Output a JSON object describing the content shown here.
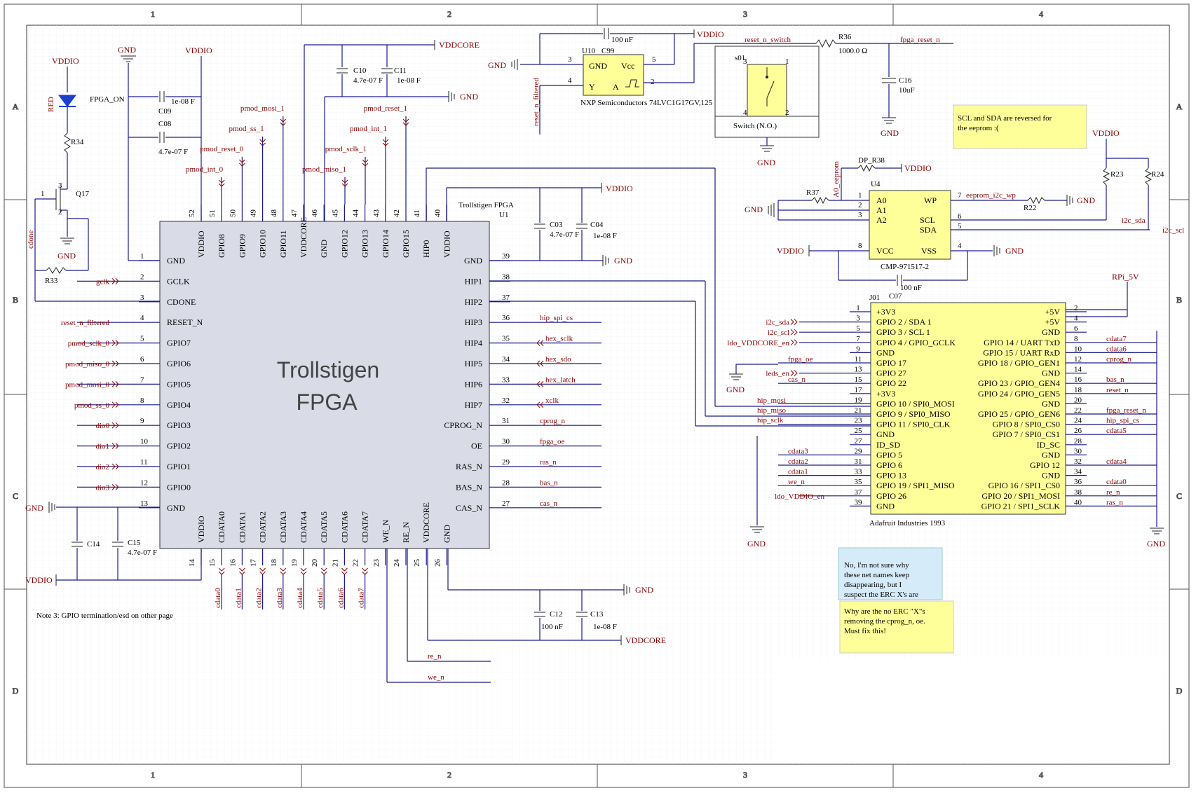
{
  "fpga": {
    "title_line1": "Trollstigen",
    "title_line2": "FPGA",
    "designator": "Trollstigen FPGA",
    "ref": "U1",
    "top_pins": [
      {
        "num": "52",
        "name": "VDDIO",
        "color": "blue"
      },
      {
        "num": "51",
        "name": "GPIO8",
        "color": "black"
      },
      {
        "num": "50",
        "name": "GPIO9",
        "color": "black"
      },
      {
        "num": "49",
        "name": "GPIO10",
        "color": "black"
      },
      {
        "num": "48",
        "name": "GPIO11",
        "color": "black"
      },
      {
        "num": "47",
        "name": "VDDCORE",
        "color": "orange"
      },
      {
        "num": "46",
        "name": "GND",
        "color": "green"
      },
      {
        "num": "45",
        "name": "GPIO12",
        "color": "black"
      },
      {
        "num": "44",
        "name": "GPIO13",
        "color": "black"
      },
      {
        "num": "43",
        "name": "GPIO14",
        "color": "black"
      },
      {
        "num": "42",
        "name": "GPIO15",
        "color": "black"
      },
      {
        "num": "41",
        "name": "HIP0",
        "color": "black"
      },
      {
        "num": "40",
        "name": "VDDIO",
        "color": "blue"
      }
    ],
    "bottom_pins": [
      {
        "num": "14",
        "name": "VDDIO",
        "color": "blue"
      },
      {
        "num": "15",
        "name": "CDATA0",
        "color": "black"
      },
      {
        "num": "16",
        "name": "CDATA1",
        "color": "black"
      },
      {
        "num": "17",
        "name": "CDATA2",
        "color": "black"
      },
      {
        "num": "18",
        "name": "CDATA3",
        "color": "black"
      },
      {
        "num": "19",
        "name": "CDATA4",
        "color": "black"
      },
      {
        "num": "20",
        "name": "CDATA5",
        "color": "black"
      },
      {
        "num": "21",
        "name": "CDATA6",
        "color": "black"
      },
      {
        "num": "22",
        "name": "CDATA7",
        "color": "black"
      },
      {
        "num": "23",
        "name": "WE_N",
        "color": "black"
      },
      {
        "num": "24",
        "name": "RE_N",
        "color": "black"
      },
      {
        "num": "25",
        "name": "VDDCORE",
        "color": "orange"
      },
      {
        "num": "26",
        "name": "GND",
        "color": "green"
      }
    ],
    "left_pins": [
      {
        "num": "1",
        "name": "GND",
        "color": "green",
        "net": ""
      },
      {
        "num": "2",
        "name": "GCLK",
        "color": "black",
        "net": "gclk"
      },
      {
        "num": "3",
        "name": "CDONE",
        "color": "black",
        "net": ""
      },
      {
        "num": "4",
        "name": "RESET_N",
        "color": "black",
        "net": "reset_n_filtered"
      },
      {
        "num": "5",
        "name": "GPIO7",
        "color": "black",
        "net": "pmod_sclk_0"
      },
      {
        "num": "6",
        "name": "GPIO6",
        "color": "black",
        "net": "pmod_miso_0"
      },
      {
        "num": "7",
        "name": "GPIO5",
        "color": "black",
        "net": "pmod_mosi_0"
      },
      {
        "num": "8",
        "name": "GPIO4",
        "color": "black",
        "net": "pmod_ss_0"
      },
      {
        "num": "9",
        "name": "GPIO3",
        "color": "black",
        "net": "dio0"
      },
      {
        "num": "10",
        "name": "GPIO2",
        "color": "black",
        "net": "dio1"
      },
      {
        "num": "11",
        "name": "GPIO1",
        "color": "black",
        "net": "dio2"
      },
      {
        "num": "12",
        "name": "GPIO0",
        "color": "black",
        "net": "dio3"
      },
      {
        "num": "13",
        "name": "GND",
        "color": "green",
        "net": ""
      }
    ],
    "right_pins": [
      {
        "num": "39",
        "name": "GND",
        "color": "green",
        "net": ""
      },
      {
        "num": "38",
        "name": "HIP1",
        "color": "black",
        "net": ""
      },
      {
        "num": "37",
        "name": "HIP2",
        "color": "black",
        "net": ""
      },
      {
        "num": "36",
        "name": "HIP3",
        "color": "black",
        "net": "hip_spi_cs"
      },
      {
        "num": "35",
        "name": "HIP4",
        "color": "black",
        "net": "hex_sclk"
      },
      {
        "num": "34",
        "name": "HIP5",
        "color": "black",
        "net": "hex_sdo"
      },
      {
        "num": "33",
        "name": "HIP6",
        "color": "black",
        "net": "hex_latch"
      },
      {
        "num": "32",
        "name": "HIP7",
        "color": "black",
        "net": "xclk"
      },
      {
        "num": "31",
        "name": "CPROG_N",
        "color": "black",
        "net": "cprog_n"
      },
      {
        "num": "30",
        "name": "OE",
        "color": "black",
        "net": "fpga_oe"
      },
      {
        "num": "29",
        "name": "RAS_N",
        "color": "black",
        "net": "ras_n"
      },
      {
        "num": "28",
        "name": "BAS_N",
        "color": "black",
        "net": "bas_n"
      },
      {
        "num": "27",
        "name": "CAS_N",
        "color": "black",
        "net": "cas_n"
      }
    ],
    "top_nets": [
      "pmod_int_0",
      "pmod_reset_0",
      "pmod_ss_1",
      "pmod_mosi_1",
      "pmod_miso_1",
      "pmod_sclk_1",
      "pmod_int_1",
      "pmod_reset_1"
    ],
    "bottom_nets": [
      "cdata0",
      "cdata1",
      "cdata2",
      "cdata3",
      "cdata4",
      "cdata5",
      "cdata6",
      "cdata7"
    ]
  },
  "labels": {
    "vddio": "VDDIO",
    "gnd": "GND",
    "vddcore": "VDDCORE",
    "rpi5v": "RPi_5V",
    "fpga_on": "FPGA_ON",
    "red": "RED",
    "r34": "R34",
    "q17": "Q17",
    "cdone": "cdone",
    "r33": "R33",
    "c09": "C09",
    "c09v": "1e-08 F",
    "c08": "C08",
    "c08v": "4.7e-07 F",
    "c10": "C10",
    "c10v": "4.7e-07 F",
    "c11": "C11",
    "c11v": "1e-08 F",
    "c03": "C03",
    "c03v": "4.7e-07 F",
    "c04": "C04",
    "c04v": "1e-08 F",
    "c12": "C12",
    "c12v": "100 nF",
    "c13": "C13",
    "c13v": "1e-08 F",
    "c14": "C14",
    "c15": "C15",
    "c15v": "4.7e-07 F",
    "u10": "U10",
    "c99": "C99",
    "c99v": "100 nF",
    "u10desc": "NXP Semiconductors 74LVC1G17GV,125",
    "u10_gnd": "GND",
    "u10_vcc": "Vcc",
    "u10_y": "Y",
    "u10_a": "A",
    "reset_n_filtered": "reset_n_filtered",
    "reset_n_switch": "reset_n_switch",
    "r36": "R36",
    "r36v": "1000.0 Ω",
    "fpga_reset_n": "fpga_reset_n",
    "c16": "C16",
    "c16v": "10uF",
    "s01": "s01",
    "switch": "Switch (N.O.)",
    "dp_r38": "DP_R38",
    "a0_eeprom": "A0_eeprom",
    "r37": "R37",
    "u4": "U4",
    "r22": "R22",
    "r23": "R23",
    "r24": "R24",
    "eeprom_i2c_wp": "eeprom_i2c_wp",
    "i2c_sda": "i2c_sda",
    "i2c_scl": "i2c_scl",
    "u4_a0": "A0",
    "u4_a1": "A1",
    "u4_a2": "A2",
    "u4_wp": "WP",
    "u4_scl": "SCL",
    "u4_sda": "SDA",
    "u4_vcc": "VCC",
    "u4_vss": "VSS",
    "u4desc": "CMP-971517-2",
    "c07": "C07",
    "c07v": "100 nF",
    "j01": "J01",
    "j01desc": "Adafruit Industries 1993",
    "hip_mosi": "hip_mosi",
    "hip_miso": "hip_miso",
    "hip_sclk": "hip_sclk",
    "re_n": "re_n",
    "we_n": "we_n",
    "note3": "Note 3: GPIO termination/esd on other page"
  },
  "j01_left": [
    {
      "num": "1",
      "name": "+3V3",
      "net": ""
    },
    {
      "num": "3",
      "name": "GPIO 2 / SDA 1",
      "net": "i2c_sda"
    },
    {
      "num": "5",
      "name": "GPIO 3 / SCL 1",
      "net": "i2c_scl"
    },
    {
      "num": "7",
      "name": "GPIO 4 / GPIO_GCLK",
      "net": "ldo_VDDCORE_en"
    },
    {
      "num": "9",
      "name": "GND",
      "net": ""
    },
    {
      "num": "11",
      "name": "GPIO 17",
      "net": "fpga_oe"
    },
    {
      "num": "13",
      "name": "GPIO 27",
      "net": "leds_en"
    },
    {
      "num": "15",
      "name": "GPIO 22",
      "net": "cas_n"
    },
    {
      "num": "17",
      "name": "+3V3",
      "net": ""
    },
    {
      "num": "19",
      "name": "GPIO 10 / SPI0_MOSI",
      "net": "hip_mosi"
    },
    {
      "num": "21",
      "name": "GPIO 9 / SPI0_MISO",
      "net": "hip_miso"
    },
    {
      "num": "23",
      "name": "GPIO 11 / SPI0_CLK",
      "net": "hip_sclk"
    },
    {
      "num": "25",
      "name": "GND",
      "net": ""
    },
    {
      "num": "27",
      "name": "ID_SD",
      "net": ""
    },
    {
      "num": "29",
      "name": "GPIO 5",
      "net": "cdata3"
    },
    {
      "num": "31",
      "name": "GPIO 6",
      "net": "cdata2"
    },
    {
      "num": "33",
      "name": "GPIO 13",
      "net": "cdata1"
    },
    {
      "num": "35",
      "name": "GPIO 19 / SPI1_MISO",
      "net": "we_n"
    },
    {
      "num": "37",
      "name": "GPIO 26",
      "net": "ldo_VDDIO_en"
    },
    {
      "num": "39",
      "name": "GND",
      "net": ""
    }
  ],
  "j01_right": [
    {
      "num": "2",
      "name": "+5V",
      "net": ""
    },
    {
      "num": "4",
      "name": "+5V",
      "net": ""
    },
    {
      "num": "6",
      "name": "GND",
      "net": ""
    },
    {
      "num": "8",
      "name": "GPIO 14 / UART TxD",
      "net": "cdata7"
    },
    {
      "num": "10",
      "name": "GPIO 15 / UART RxD",
      "net": "cdata6"
    },
    {
      "num": "12",
      "name": "GPIO 18 / GPIO_GEN1",
      "net": "cprog_n"
    },
    {
      "num": "14",
      "name": "GND",
      "net": ""
    },
    {
      "num": "16",
      "name": "GPIO 23 / GPIO_GEN4",
      "net": "bas_n"
    },
    {
      "num": "18",
      "name": "GPIO 24 / GPIO_GEN5",
      "net": "reset_n"
    },
    {
      "num": "20",
      "name": "GND",
      "net": ""
    },
    {
      "num": "22",
      "name": "GPIO 25 / GPIO_GEN6",
      "net": "fpga_reset_n"
    },
    {
      "num": "24",
      "name": "GPIO 8 / SPI0_CS0",
      "net": "hip_spi_cs"
    },
    {
      "num": "26",
      "name": "GPIO 7 / SPI0_CS1",
      "net": "cdata5"
    },
    {
      "num": "28",
      "name": "ID_SC",
      "net": ""
    },
    {
      "num": "30",
      "name": "GND",
      "net": ""
    },
    {
      "num": "32",
      "name": "GPIO 12",
      "net": "cdata4"
    },
    {
      "num": "34",
      "name": "GND",
      "net": ""
    },
    {
      "num": "36",
      "name": "GPIO 16 / SPI1_CS0",
      "net": "cdata0"
    },
    {
      "num": "38",
      "name": "GPIO 20 / SPI1_MOSI",
      "net": "re_n"
    },
    {
      "num": "40",
      "name": "GPIO 21 / SPI1_SCLK",
      "net": "ras_n"
    }
  ],
  "notes": {
    "eeprom": "SCL and SDA are reversed for the eeprom :(",
    "netnames": [
      "No, I'm not sure why",
      "these net names keep",
      "disappearing, but I",
      "suspect the ERC X's are"
    ],
    "erc": [
      "Why are the no ERC \"X\"s",
      "removing the cprog_n, oe.",
      "Must fix this!"
    ]
  },
  "zones": {
    "cols": [
      "1",
      "2",
      "3",
      "4"
    ],
    "rows": [
      "A",
      "B",
      "C",
      "D"
    ]
  }
}
